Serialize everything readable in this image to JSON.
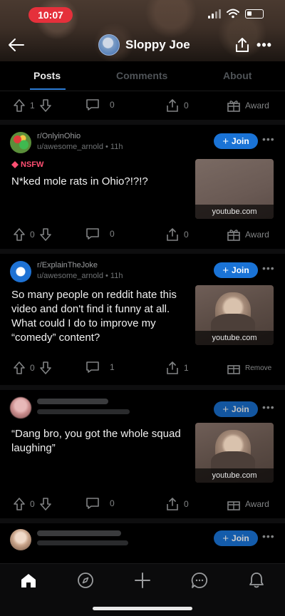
{
  "status_bar": {
    "time": "10:07"
  },
  "header": {
    "profile_name": "Sloppy Joe"
  },
  "tabs": [
    {
      "label": "Posts",
      "active": true
    },
    {
      "label": "Comments",
      "active": false
    },
    {
      "label": "About",
      "active": false
    }
  ],
  "top_actions": {
    "upvotes": "1",
    "comments": "0",
    "shares": "0",
    "award_label": "Award"
  },
  "posts": [
    {
      "subreddit": "r/OnlyinOhio",
      "meta": "u/awesome_arnold • 11h",
      "join_label": "Join",
      "nsfw_label": "NSFW",
      "title": "N*ked mole rats in Ohio?!?!?",
      "thumb_label": "youtube.com",
      "upvotes": "0",
      "comments": "0",
      "shares": "0",
      "award_label": "Award"
    },
    {
      "subreddit": "r/ExplainTheJoke",
      "meta": "u/awesome_arnold • 11h",
      "join_label": "Join",
      "title": "So many people on reddit hate this video and don't find it funny at all. What could I do to improve my “comedy” content?",
      "thumb_label": "youtube.com",
      "upvotes": "0",
      "comments": "1",
      "shares": "1",
      "award_label": "Remove"
    },
    {
      "join_label": "Join",
      "title": "“Dang bro, you got the whole squad laughing”",
      "thumb_label": "youtube.com",
      "upvotes": "0",
      "comments": "0",
      "shares": "0",
      "award_label": "Award"
    },
    {
      "join_label": "Join"
    }
  ],
  "colors": {
    "accent": "#1a73d6",
    "nsfw": "#ff4f72",
    "status_time": "#e5303b"
  }
}
